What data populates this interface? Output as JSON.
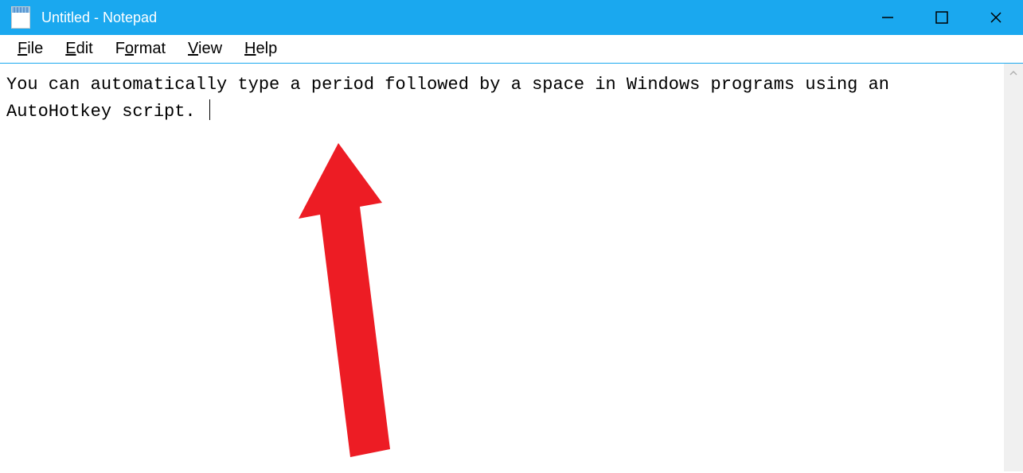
{
  "titlebar": {
    "title": "Untitled - Notepad"
  },
  "menubar": {
    "items": [
      {
        "label": "File",
        "hotkey_index": 0
      },
      {
        "label": "Edit",
        "hotkey_index": 0
      },
      {
        "label": "Format",
        "hotkey_index": 1
      },
      {
        "label": "View",
        "hotkey_index": 0
      },
      {
        "label": "Help",
        "hotkey_index": 0
      }
    ]
  },
  "editor": {
    "content": "You can automatically type a period followed by a space in Windows programs using an AutoHotkey script. "
  },
  "annotation": {
    "color": "#ed1c24"
  }
}
